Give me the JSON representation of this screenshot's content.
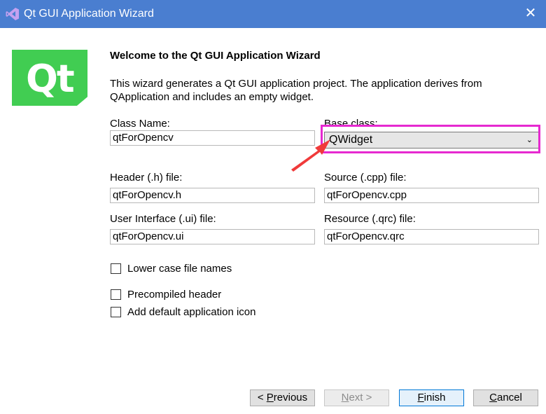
{
  "window": {
    "title": "Qt GUI Application Wizard",
    "close_glyph": "✕"
  },
  "logo": {
    "text": "Qt",
    "color": "#41cd52"
  },
  "heading": "Welcome to the Qt GUI Application Wizard",
  "description": "This wizard generates a Qt GUI application project. The application derives from QApplication and includes an empty widget.",
  "fields": {
    "class_name": {
      "label": "Class Name:",
      "value": "qtForOpencv"
    },
    "base_class": {
      "label": "Base class:",
      "value": "QWidget"
    },
    "header_file": {
      "label": "Header (.h) file:",
      "value": "qtForOpencv.h"
    },
    "source_file": {
      "label": "Source (.cpp) file:",
      "value": "qtForOpencv.cpp"
    },
    "ui_file": {
      "label": "User Interface (.ui) file:",
      "value": "qtForOpencv.ui"
    },
    "resource_file": {
      "label": "Resource (.qrc) file:",
      "value": "qtForOpencv.qrc"
    }
  },
  "checkboxes": [
    {
      "label": "Lower case file names",
      "checked": false
    },
    {
      "label": "Precompiled header",
      "checked": false
    },
    {
      "label": "Add default application icon",
      "checked": false
    }
  ],
  "buttons": {
    "previous": {
      "prefix": "< ",
      "mnemonic": "P",
      "rest": "revious"
    },
    "next": {
      "mnemonic": "N",
      "rest": "ext >"
    },
    "finish": {
      "mnemonic": "F",
      "rest": "inish"
    },
    "cancel": {
      "mnemonic": "C",
      "rest": "ancel"
    }
  },
  "colors": {
    "titlebar": "#4a7ed0",
    "annotation": "#e629d0",
    "arrow": "#f03a3a"
  }
}
